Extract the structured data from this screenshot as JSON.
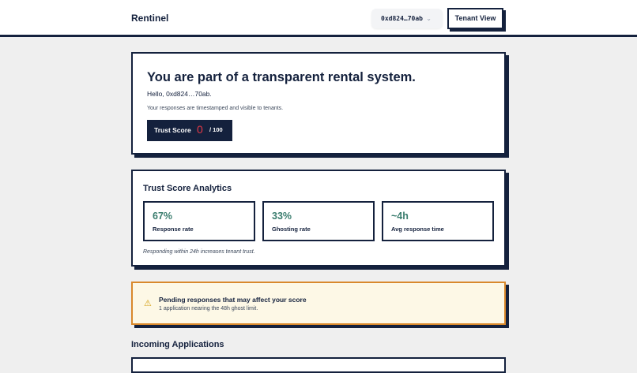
{
  "header": {
    "brand": "Rentinel",
    "wallet": "0xd824…70ab",
    "wallet_chevron": "⌄",
    "tenant_view_label": "Tenant View"
  },
  "hero": {
    "title": "You are part of a transparent rental system.",
    "greeting": "Hello, 0xd824…70ab.",
    "note": "Your responses are timestamped and visible to tenants.",
    "trust_label": "Trust Score",
    "trust_value": "0",
    "trust_max": "/ 100"
  },
  "analytics": {
    "title": "Trust Score Analytics",
    "stats": [
      {
        "value": "67%",
        "label": "Response rate"
      },
      {
        "value": "33%",
        "label": "Ghosting rate"
      },
      {
        "value": "~4h",
        "label": "Avg response time"
      }
    ],
    "footnote": "Responding within 24h increases tenant trust."
  },
  "alert": {
    "icon": "warning-icon",
    "icon_glyph": "⚠",
    "title": "Pending responses that may affect your score",
    "subtitle": "1 application nearing the 48h ghost limit."
  },
  "applications": {
    "title": "Incoming Applications"
  },
  "colors": {
    "navy": "#14213d",
    "accent_red": "#e63946",
    "stat_green": "#3a7d6e",
    "warning_border": "#d9892c",
    "warning_bg": "#fdf8e6"
  }
}
